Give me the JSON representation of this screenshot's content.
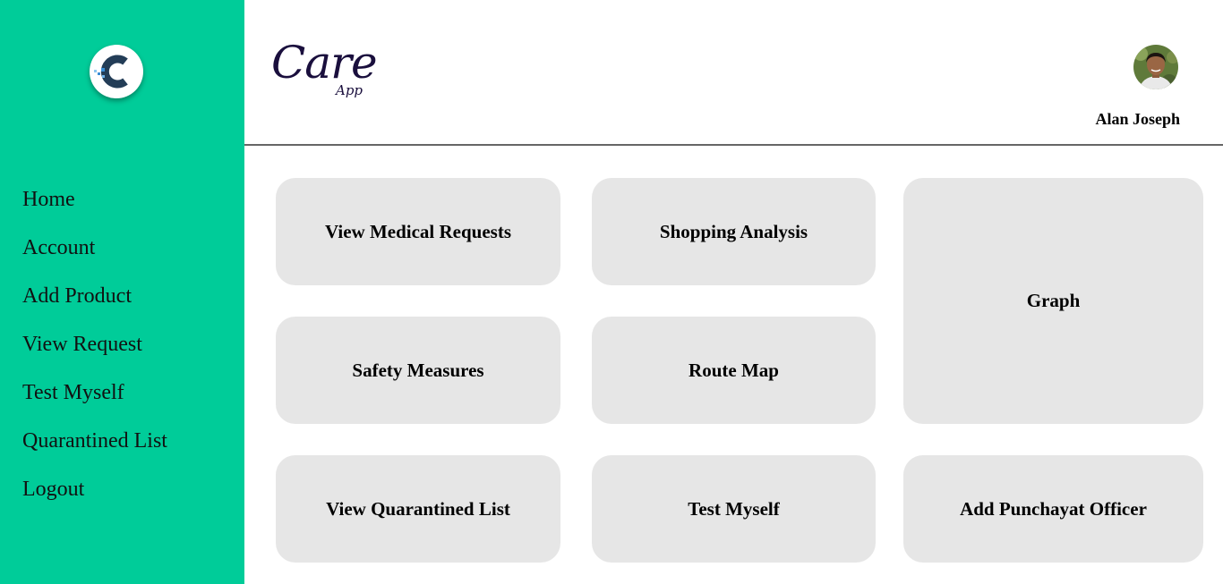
{
  "sidebar": {
    "logo_icon": "care-app-c-logo",
    "items": [
      {
        "label": "Home"
      },
      {
        "label": "Account"
      },
      {
        "label": "Add Product"
      },
      {
        "label": "View Request"
      },
      {
        "label": "Test Myself"
      },
      {
        "label": "Quarantined List"
      },
      {
        "label": "Logout"
      }
    ]
  },
  "header": {
    "brand_main": "Care",
    "brand_sub": "App",
    "user_name": "Alan Joseph",
    "avatar_icon": "user-avatar"
  },
  "tiles": {
    "view_medical_requests": "View Medical Requests",
    "shopping_analysis": "Shopping Analysis",
    "graph": "Graph",
    "safety_measures": "Safety Measures",
    "route_map": "Route Map",
    "view_quarantined_list": "View Quarantined List",
    "test_myself": "Test Myself",
    "add_punchayat_officer": "Add Punchayat Officer"
  },
  "colors": {
    "sidebar_bg": "#00cc99",
    "tile_bg": "#e6e6e6",
    "brand_text": "#1a0f3d",
    "divider": "#666666"
  }
}
